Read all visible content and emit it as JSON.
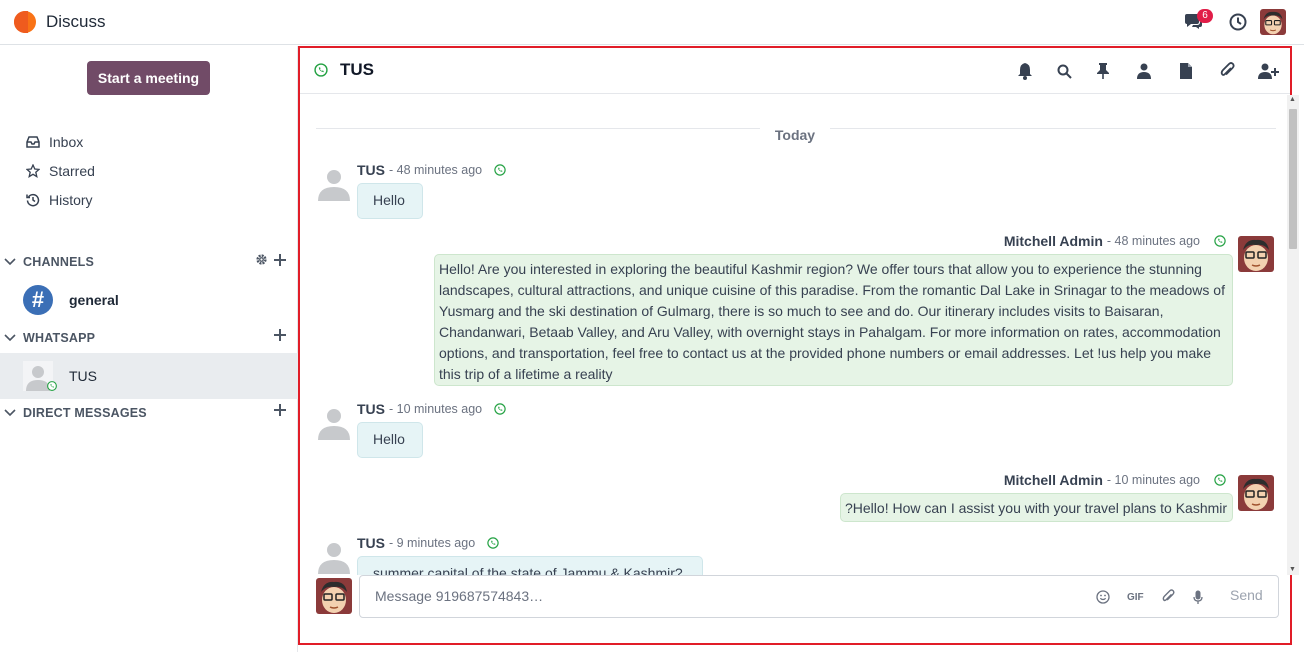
{
  "app": {
    "title": "Discuss",
    "logo_icon": "odoo-discuss-logo"
  },
  "topbar": {
    "messages_badge": "6",
    "accent": "#714b67"
  },
  "sidebar": {
    "start_meeting": "Start a meeting",
    "nav": [
      {
        "label": "Inbox",
        "icon": "inbox-icon"
      },
      {
        "label": "Starred",
        "icon": "star-icon"
      },
      {
        "label": "History",
        "icon": "history-icon"
      }
    ],
    "categories": {
      "channels": "CHANNELS",
      "whatsapp": "WHATSAPP",
      "direct": "DIRECT MESSAGES"
    },
    "channels": [
      {
        "name": "general"
      }
    ],
    "whatsapp_chats": [
      {
        "name": "TUS"
      }
    ]
  },
  "thread": {
    "name": "TUS",
    "date_separator": "Today",
    "messages": [
      {
        "author": "TUS",
        "time": "- 48 minutes ago",
        "text": "Hello"
      },
      {
        "author": "Mitchell Admin",
        "time": "- 48 minutes ago",
        "text": "Hello! Are you interested in exploring the beautiful Kashmir region? We offer tours that allow you to experience the stunning landscapes, cultural attractions, and unique cuisine of this paradise. From the romantic Dal Lake in Srinagar to the meadows of Yusmarg and the ski destination of Gulmarg, there is so much to see and do. Our itinerary includes visits to Baisaran, Chandanwari, Betaab Valley, and Aru Valley, with overnight stays in Pahalgam. For more information on rates, accommodation options, and transportation, feel free to contact us at the provided phone numbers or email addresses. Let !us help you make this trip of a lifetime a reality"
      },
      {
        "author": "TUS",
        "time": "- 10 minutes ago",
        "text": "Hello"
      },
      {
        "author": "Mitchell Admin",
        "time": "- 10 minutes ago",
        "text": "?Hello! How can I assist you with your travel plans to Kashmir"
      },
      {
        "author": "TUS",
        "time": "- 9 minutes ago",
        "text": "summer capital of the state of Jammu & Kashmir?"
      }
    ]
  },
  "composer": {
    "placeholder": "Message 919687574843…",
    "gif_label": "GIF",
    "send_label": "Send"
  }
}
